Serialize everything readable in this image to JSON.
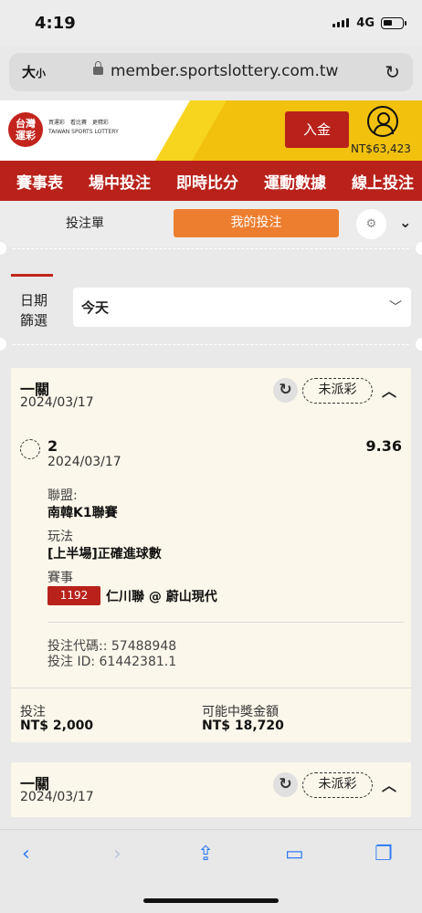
{
  "status_bar": {
    "time": "4:19",
    "network": "4G"
  },
  "browser": {
    "text_size_label": "大",
    "text_size_small": "小",
    "url": "member.sportslottery.com.tw"
  },
  "header": {
    "logo_line1": "台灣",
    "logo_line2": "運彩",
    "logo_tagline1": "買運彩　看比賽　更精彩",
    "logo_tagline2": "TAIWAN SPORTS LOTTERY",
    "deposit_label": "入金",
    "balance": "NT$63,423"
  },
  "nav": {
    "items": [
      "賽事表",
      "場中投注",
      "即時比分",
      "運動數據",
      "線上投注"
    ]
  },
  "tabs": {
    "bet_slip": "投注單",
    "my_bets": "我的投注"
  },
  "filter": {
    "label_line1": "日期",
    "label_line2": "篩選",
    "selected": "今天"
  },
  "bets": [
    {
      "type": "一關",
      "date": "2024/03/17",
      "status": "未派彩",
      "selection": "2",
      "selection_date": "2024/03/17",
      "odds": "9.36",
      "league_label": "聯盟:",
      "league": "南韓K1聯賽",
      "market_label": "玩法",
      "market": "[上半場]正確進球數",
      "event_label": "賽事",
      "event_id": "1192",
      "event_name": "仁川聯 @ 蔚山現代",
      "bet_code": "投注代碼:: 57488948",
      "bet_id": "投注 ID: 61442381.1",
      "stake_label": "投注",
      "stake": "NT$ 2,000",
      "payout_label": "可能中獎金額",
      "payout": "NT$ 18,720"
    },
    {
      "type": "一關",
      "date": "2024/03/17",
      "status": "未派彩"
    }
  ],
  "colors": {
    "brand_red": "#b8221b",
    "orange": "#ee7e2f",
    "yellow": "#f7d51f",
    "ios_blue": "#2f7bf6"
  }
}
